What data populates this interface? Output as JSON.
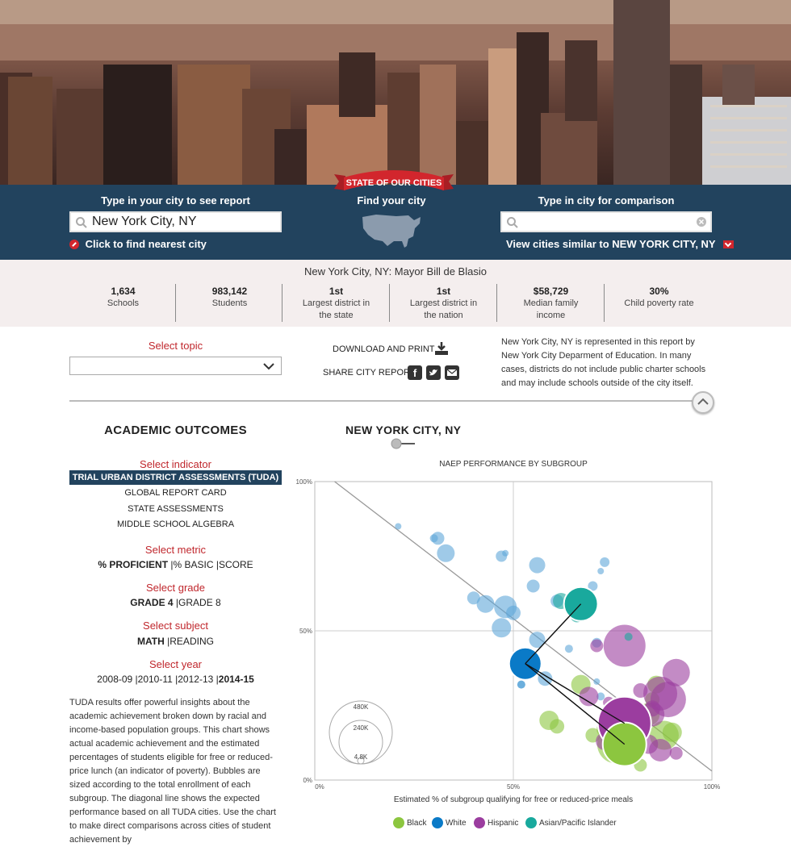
{
  "banner": {
    "ribbon_text": "STATE OF OUR CITIES"
  },
  "search": {
    "label_left": "Type in your city to see report",
    "city_value": "New York City, NY",
    "nearest_label": "Click to find nearest city",
    "label_center": "Find your city",
    "label_right": "Type in city for comparison",
    "compare_value": "",
    "similar_prefix": "View cities similar to ",
    "similar_city": "NEW YORK CITY, NY"
  },
  "stats": {
    "mayor_line": "New York City, NY: Mayor Bill de Blasio",
    "items": [
      {
        "value": "1,634",
        "label": "Schools"
      },
      {
        "value": "983,142",
        "label": "Students"
      },
      {
        "value": "1st",
        "label": "Largest district in the state"
      },
      {
        "value": "1st",
        "label": "Largest district in the nation"
      },
      {
        "value": "$58,729",
        "label": "Median family income"
      },
      {
        "value": "30%",
        "label": "Child poverty rate"
      }
    ]
  },
  "tools": {
    "select_topic": "Select topic",
    "topic_value": "",
    "download_label": "DOWNLOAD AND PRINT",
    "share_label": "SHARE CITY REPORT",
    "note": "New York City, NY is represented in this report by New York City Deparment of Education. In many cases, districts do not include public charter schools and may include schools outside of the city itself."
  },
  "left": {
    "section_title": "ACADEMIC OUTCOMES",
    "select_indicator": "Select indicator",
    "indicators": [
      "TRIAL URBAN DISTRICT ASSESSMENTS (TUDA)",
      "GLOBAL REPORT CARD",
      "STATE ASSESSMENTS",
      "MIDDLE SCHOOL ALGEBRA"
    ],
    "select_metric": "Select metric",
    "metric_active": "% PROFICIENT",
    "metric_rest": "% BASIC |SCORE",
    "select_grade": "Select grade",
    "grade_active": "GRADE 4",
    "grade_rest": "GRADE 8",
    "select_subject": "Select subject",
    "subject_active": "MATH",
    "subject_rest": "READING",
    "select_year": "Select year",
    "years_rest": "2008-09 |2010-11 |2012-13 |",
    "year_active": "2014-15",
    "description": "TUDA results offer powerful insights about the academic achievement broken down by racial and income-based population groups. This chart shows actual academic achievement and the estimated percentages of students eligible for free or reduced-price lunch (an indicator of poverty). Bubbles are sized according to the total enrollment of each subgroup. The diagonal line shows the expected performance based on all TUDA cities. Use the chart to make direct comparisons across cities of student achievement by"
  },
  "chart_header": {
    "city_title": "NEW YORK CITY, NY"
  },
  "chart_data": {
    "type": "scatter",
    "title": "NAEP PERFORMANCE BY SUBGROUP",
    "xlabel": "Estimated % of subgroup qualifying for free or reduced-price meals",
    "ylabel": "",
    "xlim": [
      0,
      100
    ],
    "ylim": [
      0,
      100
    ],
    "x_ticks": [
      "0%",
      "50%",
      "100%"
    ],
    "y_ticks": [
      "0%",
      "50%",
      "100%"
    ],
    "size_legend": [
      "480K",
      "240K",
      "4.8K"
    ],
    "colors": {
      "Black": "#8cc63f",
      "White": "#0a7ac7",
      "Hispanic": "#9b3d9f",
      "Asian/Pacific Islander": "#19a99d",
      "Other": "#5fa6d8"
    },
    "legend": [
      "Black",
      "White",
      "Hispanic",
      "Asian/Pacific Islander"
    ],
    "trend": {
      "x": [
        5,
        100
      ],
      "y": [
        100,
        3
      ]
    },
    "highlight": {
      "group": "White",
      "x": 53,
      "y": 39
    },
    "highlight_links": [
      {
        "x": 67,
        "y": 59
      },
      {
        "x": 78,
        "y": 19
      },
      {
        "x": 78,
        "y": 12
      }
    ],
    "series": [
      {
        "name": "",
        "group": "Other",
        "points": [
          [
            21,
            85,
            4
          ],
          [
            30,
            81,
            5
          ],
          [
            31,
            81,
            8
          ],
          [
            33,
            76,
            11
          ],
          [
            47,
            75,
            7
          ],
          [
            48,
            76,
            4
          ],
          [
            56,
            72,
            10
          ],
          [
            55,
            65,
            8
          ],
          [
            40,
            61,
            8
          ],
          [
            43,
            59,
            11
          ],
          [
            48,
            58,
            14
          ],
          [
            47,
            51,
            12
          ],
          [
            50,
            56,
            9
          ],
          [
            56,
            47,
            10
          ],
          [
            61,
            60,
            8
          ],
          [
            70,
            65,
            6
          ],
          [
            58,
            34,
            9
          ],
          [
            73,
            73,
            6
          ],
          [
            72,
            70,
            4
          ],
          [
            67,
            62,
            9
          ],
          [
            71,
            46,
            6
          ],
          [
            71,
            33,
            4
          ],
          [
            72,
            28,
            5
          ],
          [
            64,
            44,
            5
          ]
        ]
      },
      {
        "name": "Black",
        "group": "Black",
        "points": [
          [
            59,
            20,
            12
          ],
          [
            61,
            18,
            9
          ],
          [
            67,
            32,
            12
          ],
          [
            70,
            15,
            9
          ],
          [
            73,
            17,
            10
          ],
          [
            75,
            22,
            11
          ],
          [
            80,
            24,
            13
          ],
          [
            84,
            22,
            14
          ],
          [
            85,
            27,
            9
          ],
          [
            88,
            15,
            18
          ],
          [
            90,
            16,
            12
          ],
          [
            86,
            32,
            11
          ],
          [
            82,
            5,
            8
          ],
          [
            76,
            12,
            24
          ]
        ]
      },
      {
        "name": "Hispanic",
        "group": "Hispanic",
        "points": [
          [
            71,
            45,
            8
          ],
          [
            74,
            26,
            7
          ],
          [
            75,
            22,
            6
          ],
          [
            78,
            45,
            26
          ],
          [
            82,
            30,
            9
          ],
          [
            85,
            22,
            15
          ],
          [
            85,
            24,
            10
          ],
          [
            87,
            29,
            21
          ],
          [
            91,
            36,
            17
          ],
          [
            89,
            27,
            22
          ],
          [
            82,
            21,
            10
          ],
          [
            84,
            12,
            12
          ],
          [
            87,
            10,
            14
          ],
          [
            91,
            9,
            8
          ],
          [
            73,
            13,
            11
          ],
          [
            69,
            28,
            12
          ],
          [
            78,
            19,
            30
          ]
        ]
      },
      {
        "name": "Asian/Pacific Islander",
        "group": "Asian/Pacific Islander",
        "points": [
          [
            67,
            59,
            20
          ],
          [
            62,
            60,
            10
          ],
          [
            66,
            55,
            8
          ],
          [
            79,
            48,
            5
          ]
        ]
      },
      {
        "name": "White",
        "group": "White",
        "points": [
          [
            53,
            39,
            20
          ],
          [
            54,
            42,
            7
          ],
          [
            52,
            32,
            5
          ]
        ]
      }
    ]
  }
}
